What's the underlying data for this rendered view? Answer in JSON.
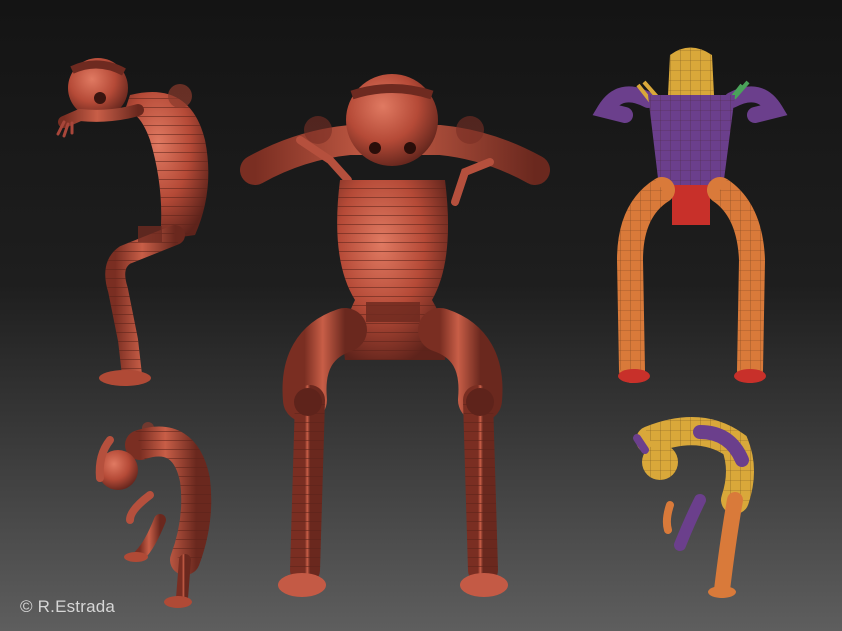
{
  "credit": {
    "symbol": "©",
    "text": "R.Estrada"
  },
  "colors": {
    "clay_base": "#b8503d",
    "clay_dark": "#6e2a20",
    "clay_light": "#d8705a",
    "poly_orange": "#d97a3a",
    "poly_purple": "#6b3f8c",
    "poly_yellow": "#d9a83a",
    "poly_red": "#c8302a"
  },
  "figures": [
    {
      "name": "side-hunched-figure",
      "material": "clay"
    },
    {
      "name": "front-crouch-figure",
      "material": "clay"
    },
    {
      "name": "polygroup-front-figure",
      "material": "polygroups"
    },
    {
      "name": "curled-pose-figure",
      "material": "clay"
    },
    {
      "name": "polygroup-curled-figure",
      "material": "polygroups"
    }
  ]
}
